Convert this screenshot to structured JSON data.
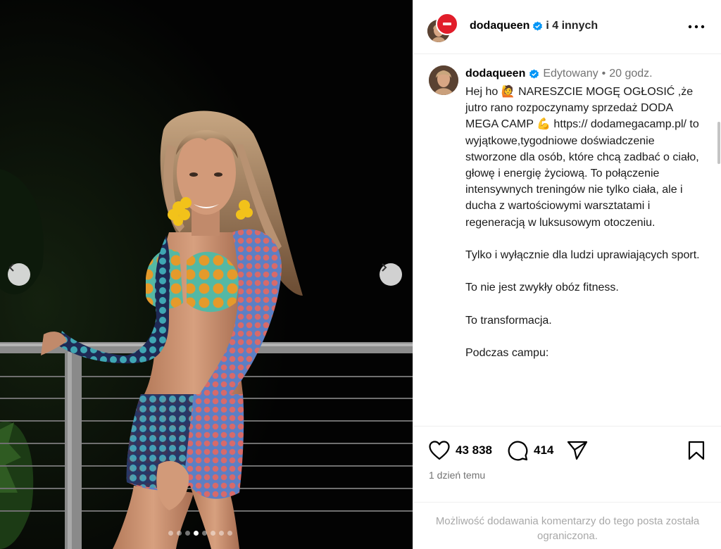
{
  "media": {
    "prev_label": "Poprzednie",
    "next_label": "Następne",
    "slide_count": 8,
    "active_slide": 4
  },
  "header": {
    "username": "dodaqueen",
    "others": "i 4 innych",
    "more_label": "Więcej opcji"
  },
  "caption": {
    "username": "dodaqueen",
    "edited": "Edytowany",
    "separator": "•",
    "time": "20 godz.",
    "paragraphs": [
      "Hej ho 🙋 NARESZCIE MOGĘ OGŁOSIĆ ,że jutro rano rozpoczynamy sprzedaż DODA MEGA CAMP 💪 https:// dodamegacamp.pl/  to wyjątkowe,tygodniowe  doświadczenie stworzone dla osób, które chcą zadbać o ciało, głowę i energię życiową. To połączenie intensywnych treningów nie tylko ciała, ale i ducha z wartościowymi warsztatami i regeneracją w luksusowym otoczeniu.",
      "Tylko i wyłącznie dla ludzi uprawiających sport.",
      "To nie jest zwykły obóz fitness.",
      "To transformacja.",
      "Podczas campu:"
    ]
  },
  "actions": {
    "likes": "43 838",
    "comments": "414",
    "posted": "1 dzień temu"
  },
  "comments_disabled": "Możliwość dodawania komentarzy do tego posta została ograniczona.",
  "colors": {
    "verified": "#0095f6",
    "muted": "#737373",
    "divider": "#efefef"
  }
}
